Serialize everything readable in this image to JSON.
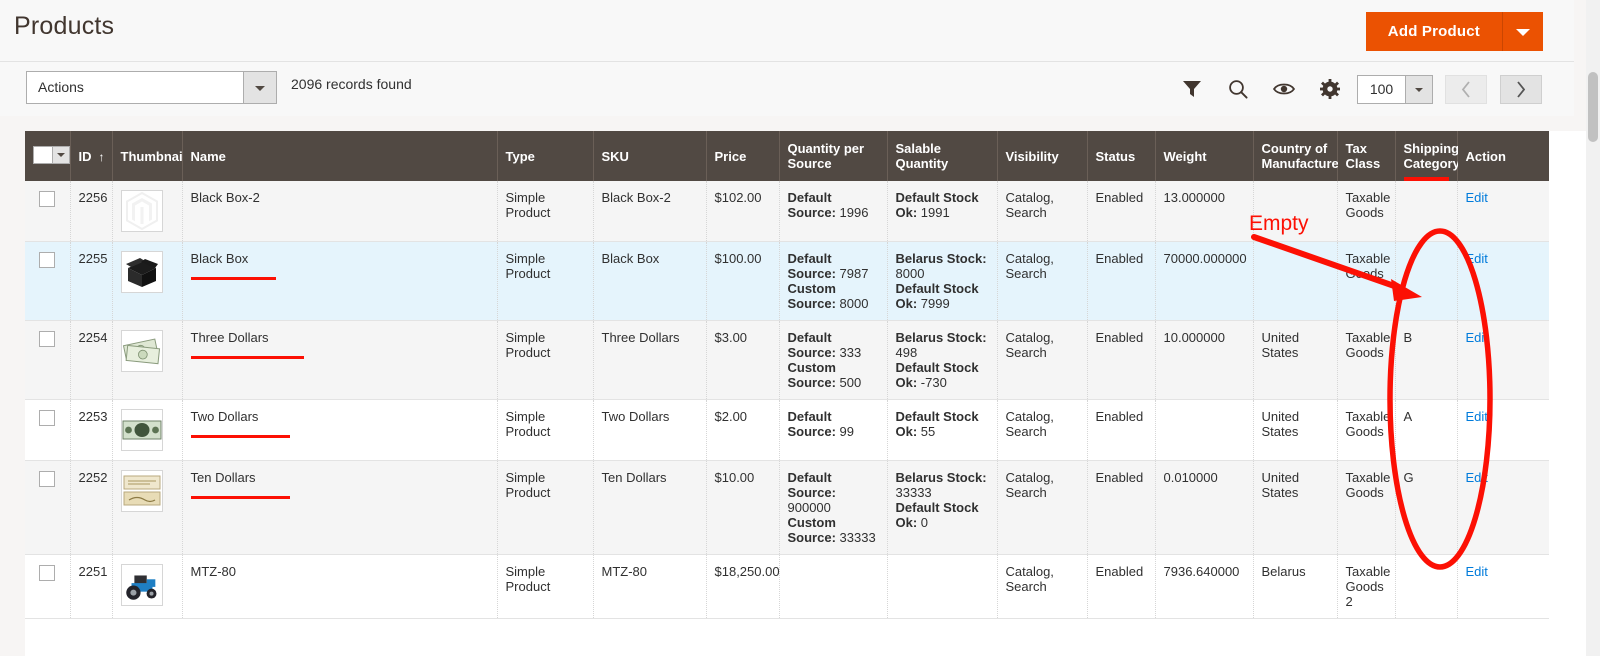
{
  "header": {
    "title": "Products",
    "add_product_label": "Add Product",
    "add_product_caret_icon": "chevron-down-icon"
  },
  "toolbar": {
    "actions_label": "Actions",
    "records_found": "2096 records found",
    "icons": [
      {
        "name": "filter-icon",
        "label": "Filters"
      },
      {
        "name": "search-icon",
        "label": "Search by keyword"
      },
      {
        "name": "eye-icon",
        "label": "Default View"
      },
      {
        "name": "gear-icon",
        "label": "Columns"
      }
    ],
    "per_page": "100",
    "per_page_caret_icon": "chevron-down-icon",
    "prev_page_icon": "chevron-left-icon",
    "next_page_icon": "chevron-right-icon"
  },
  "grid": {
    "columns": [
      {
        "key": "select",
        "label": ""
      },
      {
        "key": "id",
        "label": "ID",
        "sort": "↑"
      },
      {
        "key": "thumbnail",
        "label": "Thumbnail"
      },
      {
        "key": "name",
        "label": "Name"
      },
      {
        "key": "type",
        "label": "Type"
      },
      {
        "key": "sku",
        "label": "SKU"
      },
      {
        "key": "price",
        "label": "Price"
      },
      {
        "key": "qty_per_source",
        "label": "Quantity per Source"
      },
      {
        "key": "salable_qty",
        "label": "Salable Quantity"
      },
      {
        "key": "visibility",
        "label": "Visibility"
      },
      {
        "key": "status",
        "label": "Status"
      },
      {
        "key": "weight",
        "label": "Weight"
      },
      {
        "key": "country",
        "label": "Country of Manufacture"
      },
      {
        "key": "tax_class",
        "label": "Tax Class"
      },
      {
        "key": "shipping_category",
        "label": "Shipping Category"
      },
      {
        "key": "action",
        "label": "Action"
      }
    ],
    "rows": [
      {
        "id": "2256",
        "thumbnail_icon": "magento-placeholder-icon",
        "name": "Black Box-2",
        "name_underlined": false,
        "type": "Simple Product",
        "sku": "Black Box-2",
        "price": "$102.00",
        "qty_per_source": [
          {
            "label": "Default Source:",
            "value": "1996"
          }
        ],
        "salable_qty": [
          {
            "label": "Default Stock Ok:",
            "value": "1991"
          }
        ],
        "visibility": "Catalog, Search",
        "status": "Enabled",
        "weight": "13.000000",
        "country": "",
        "tax_class": "Taxable Goods",
        "shipping_category": "",
        "action": "Edit",
        "selected": false
      },
      {
        "id": "2255",
        "thumbnail_icon": "open-black-box-icon",
        "name": "Black Box",
        "name_underlined": true,
        "type": "Simple Product",
        "sku": "Black Box",
        "price": "$100.00",
        "qty_per_source": [
          {
            "label": "Default Source:",
            "value": "7987"
          },
          {
            "label": "Custom Source:",
            "value": "8000"
          }
        ],
        "salable_qty": [
          {
            "label": "Belarus Stock:",
            "value": "8000"
          },
          {
            "label": "Default Stock Ok:",
            "value": "7999"
          }
        ],
        "visibility": "Catalog, Search",
        "status": "Enabled",
        "weight": "70000.000000",
        "country": "",
        "tax_class": "Taxable Goods",
        "shipping_category": "",
        "action": "Edit",
        "selected": true
      },
      {
        "id": "2254",
        "thumbnail_icon": "dollar-bills-fan-icon",
        "name": "Three Dollars",
        "name_underlined": true,
        "type": "Simple Product",
        "sku": "Three Dollars",
        "price": "$3.00",
        "qty_per_source": [
          {
            "label": "Default Source:",
            "value": "333"
          },
          {
            "label": "Custom Source:",
            "value": "500"
          }
        ],
        "salable_qty": [
          {
            "label": "Belarus Stock:",
            "value": "498"
          },
          {
            "label": "Default Stock Ok:",
            "value": "-730"
          }
        ],
        "visibility": "Catalog, Search",
        "status": "Enabled",
        "weight": "10.000000",
        "country": "United States",
        "tax_class": "Taxable Goods",
        "shipping_category": "B",
        "action": "Edit",
        "selected": false
      },
      {
        "id": "2253",
        "thumbnail_icon": "two-dollar-bill-icon",
        "name": "Two Dollars",
        "name_underlined": true,
        "type": "Simple Product",
        "sku": "Two Dollars",
        "price": "$2.00",
        "qty_per_source": [
          {
            "label": "Default Source:",
            "value": "99"
          }
        ],
        "salable_qty": [
          {
            "label": "Default Stock Ok:",
            "value": "55"
          }
        ],
        "visibility": "Catalog, Search",
        "status": "Enabled",
        "weight": "",
        "country": "United States",
        "tax_class": "Taxable Goods",
        "shipping_category": "A",
        "action": "Edit",
        "selected": false
      },
      {
        "id": "2252",
        "thumbnail_icon": "ten-dollar-note-icon",
        "name": "Ten Dollars",
        "name_underlined": true,
        "type": "Simple Product",
        "sku": "Ten Dollars",
        "price": "$10.00",
        "qty_per_source": [
          {
            "label": "Default Source:",
            "value": "900000"
          },
          {
            "label": "Custom Source:",
            "value": "33333"
          }
        ],
        "salable_qty": [
          {
            "label": "Belarus Stock:",
            "value": "33333"
          },
          {
            "label": "Default Stock Ok:",
            "value": "0"
          }
        ],
        "visibility": "Catalog, Search",
        "status": "Enabled",
        "weight": "0.010000",
        "country": "United States",
        "tax_class": "Taxable Goods",
        "shipping_category": "G",
        "action": "Edit",
        "selected": false
      },
      {
        "id": "2251",
        "thumbnail_icon": "blue-tractor-icon",
        "name": "MTZ-80",
        "name_underlined": false,
        "type": "Simple Product",
        "sku": "MTZ-80",
        "price": "$18,250.00",
        "qty_per_source": [],
        "salable_qty": [],
        "visibility": "Catalog, Search",
        "status": "Enabled",
        "weight": "7936.640000",
        "country": "Belarus",
        "tax_class": "Taxable Goods 2",
        "shipping_category": "",
        "action": "Edit",
        "selected": false
      }
    ]
  },
  "annotations": {
    "empty_label": "Empty",
    "color": "#fc1004",
    "arrow_icon": "arrow-pointing-right-icon",
    "ellipse_icon": "ellipse-highlight-icon",
    "header_underline_target": "Shipping Category"
  },
  "colors": {
    "brand_orange": "#eb5202",
    "header_dark": "#514943",
    "link_blue": "#007bdb",
    "selected_row": "#e5f4fc",
    "annotation_red": "#fc1004"
  }
}
